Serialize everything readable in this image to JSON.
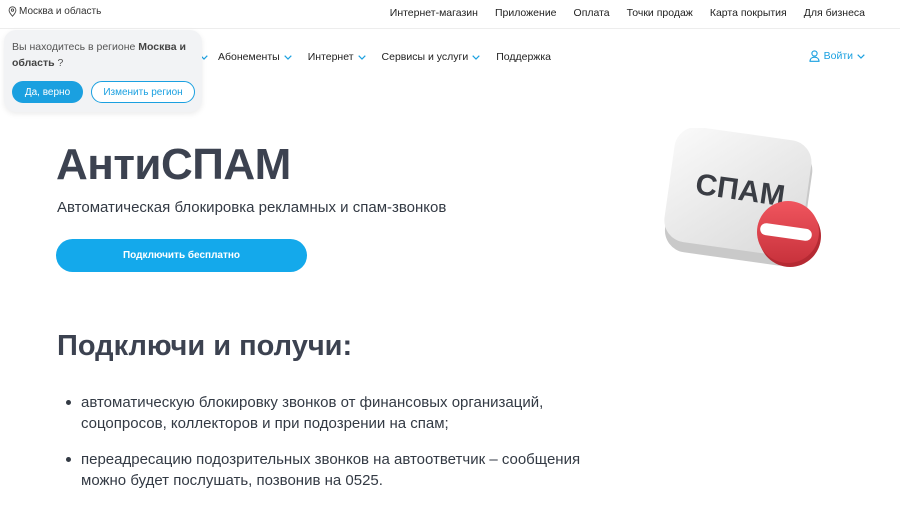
{
  "top_bar": {
    "region": "Москва и область",
    "links": [
      "Интернет-магазин",
      "Приложение",
      "Оплата",
      "Точки продаж",
      "Карта покрытия",
      "Для бизнеса"
    ]
  },
  "nav": {
    "items": [
      {
        "label": "Абонементы"
      },
      {
        "label": "Интернет"
      },
      {
        "label": "Сервисы и услуги"
      },
      {
        "label": "Поддержка"
      }
    ],
    "login": "Войти"
  },
  "region_popup": {
    "text_prefix": "Вы находитесь в регионе ",
    "region_bold": "Москва и область",
    "text_suffix": " ?",
    "confirm": "Да, верно",
    "change": "Изменить регион"
  },
  "hero": {
    "title": "АнтиСПАМ",
    "subtitle": "Автоматическая блокировка рекламных и спам-звонков",
    "cta": "Подключить бесплатно",
    "illustration_label": "СПАМ"
  },
  "benefits": {
    "title": "Подключи и получи:",
    "items": [
      "автоматическую блокировку звонков от финансовых организаций, соцопросов, коллекторов и при подозрении на спам;",
      "переадресацию подозрительных звонков на автоответчик – сообщения можно будет послушать, позвонив на 0525."
    ]
  },
  "colors": {
    "accent": "#1aa0e0",
    "stop_red": "#e0404a",
    "heading": "#3c4250"
  }
}
